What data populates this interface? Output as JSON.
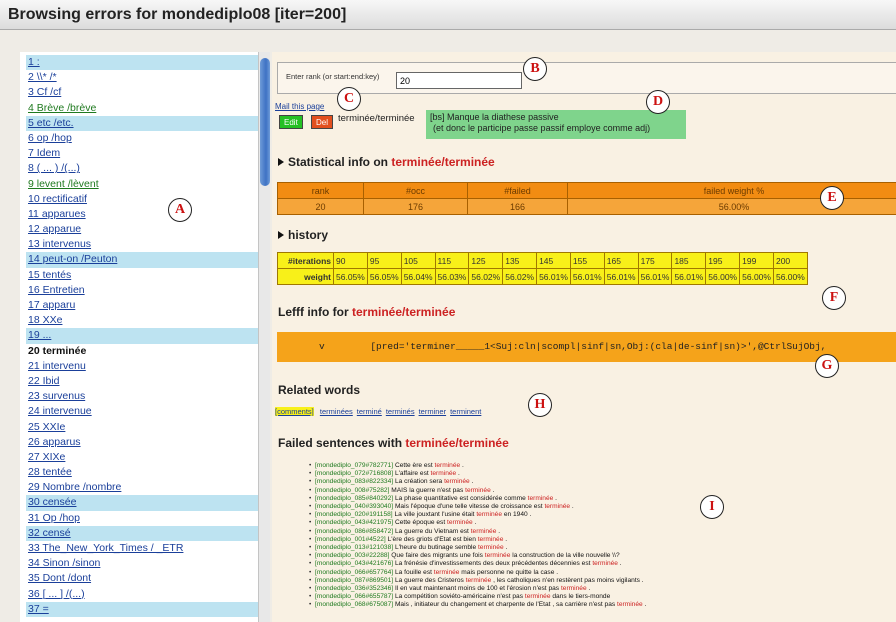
{
  "window": {
    "title": "Browsing errors for mondediplo08 [iter=200]"
  },
  "sidebar": {
    "items": [
      {
        "label": "1 :",
        "hl": true
      },
      {
        "label": "2 \\\\* /*",
        "hl": false
      },
      {
        "label": "3 Cf /cf",
        "hl": false
      },
      {
        "label": "4 Brève /brève",
        "hl": false
      },
      {
        "label": "5 etc /etc.",
        "hl": true
      },
      {
        "label": "6 op /hop",
        "hl": false
      },
      {
        "label": "7 Idem",
        "hl": false
      },
      {
        "label": "8 ( ... ) /(...)",
        "hl": false
      },
      {
        "label": "9 levent /lèvent",
        "hl": false
      },
      {
        "label": "10 rectificatif",
        "hl": false
      },
      {
        "label": "11 apparues",
        "hl": false
      },
      {
        "label": "12 apparue",
        "hl": false
      },
      {
        "label": "13 intervenus",
        "hl": false
      },
      {
        "label": "14 peut-on /Peuton",
        "hl": true
      },
      {
        "label": "15 tentés",
        "hl": false
      },
      {
        "label": "16 Entretien",
        "hl": false
      },
      {
        "label": "17 apparu",
        "hl": false
      },
      {
        "label": "18 XXe",
        "hl": false
      },
      {
        "label": "19 ...",
        "hl": true
      },
      {
        "label": "20 terminée",
        "hl": false,
        "current": true
      },
      {
        "label": "21 intervenu",
        "hl": false
      },
      {
        "label": "22 Ibid",
        "hl": false
      },
      {
        "label": "23 survenus",
        "hl": false
      },
      {
        "label": "24 intervenue",
        "hl": false
      },
      {
        "label": "25 XXIe",
        "hl": false
      },
      {
        "label": "26 apparus",
        "hl": false
      },
      {
        "label": "27 XIXe",
        "hl": false
      },
      {
        "label": "28 tentée",
        "hl": false
      },
      {
        "label": "29 Nombre /nombre",
        "hl": false
      },
      {
        "label": "30 censée",
        "hl": true
      },
      {
        "label": "31 Op /hop",
        "hl": false
      },
      {
        "label": "32 censé",
        "hl": true
      },
      {
        "label": "33 The_New_York_Times / _ETR",
        "hl": false
      },
      {
        "label": "34 Sinon /sinon",
        "hl": false
      },
      {
        "label": "35 Dont /dont",
        "hl": false
      },
      {
        "label": "36 [ ... ] /(...)",
        "hl": false
      },
      {
        "label": "37 =",
        "hl": true
      }
    ]
  },
  "rank": {
    "label": "Enter rank (or start:end:key)",
    "value": "20"
  },
  "entry": {
    "mail_link": "Mail this page",
    "edit_label": "Edit",
    "del_label": "Del",
    "word": "terminée/terminée",
    "comment_line1": "[bs]  Manque la diathese passive",
    "comment_line2": "(et donc le participe passe passif employe comme adj)"
  },
  "stats": {
    "title_prefix": "Statistical info on ",
    "title_word": "terminée/terminée",
    "headers": [
      "rank",
      "#occ",
      "#failed",
      "failed weight %"
    ],
    "values": [
      "20",
      "176",
      "166",
      "56.00%"
    ]
  },
  "history": {
    "title": "history",
    "row1_label": "#iterations",
    "row2_label": "weight",
    "iterations": [
      "90",
      "95",
      "105",
      "115",
      "125",
      "135",
      "145",
      "155",
      "165",
      "175",
      "185",
      "195",
      "199",
      "200"
    ],
    "weights": [
      "56.05%",
      "56.05%",
      "56.04%",
      "56.03%",
      "56.02%",
      "56.02%",
      "56.01%",
      "56.01%",
      "56.01%",
      "56.01%",
      "56.01%",
      "56.00%",
      "56.00%",
      "56.00%"
    ]
  },
  "lefff": {
    "title_prefix": "Lefff info for ",
    "title_word": "terminée/terminée",
    "category": "v",
    "content": "[pred='terminer_____1<Suj:cln|scompl|sinf|sn,Obj:(cla|de-sinf|sn)>',@CtrlSujObj,"
  },
  "related": {
    "title": "Related words",
    "comments_label": "[comments]",
    "words": [
      "terminées",
      "terminé",
      "terminés",
      "terminer",
      "terminent"
    ]
  },
  "failed": {
    "title_prefix": "Failed sentences with ",
    "title_word": "terminée/terminée",
    "sentences": [
      {
        "id": "[mondediplo_079#782771]",
        "before": " Cette ère est ",
        "word": "terminée",
        "after": " ."
      },
      {
        "id": "[mondediplo_072#716808]",
        "before": " L'affaire est ",
        "word": "terminée",
        "after": " ."
      },
      {
        "id": "[mondediplo_083#822334]",
        "before": " La création sera ",
        "word": "terminée",
        "after": " ."
      },
      {
        "id": "[mondediplo_008#75282]",
        "before": " MAIS la guerre n'est pas ",
        "word": "terminée",
        "after": " ."
      },
      {
        "id": "[mondediplo_085#840292]",
        "before": " La phase quantitative est considérée comme ",
        "word": "terminée",
        "after": " ."
      },
      {
        "id": "[mondediplo_040#393040]",
        "before": " Mais l'époque d'une telle vitesse de croissance est ",
        "word": "terminée",
        "after": " ."
      },
      {
        "id": "[mondediplo_020#191158]",
        "before": " La ville jouxtant l'usine était ",
        "word": "terminée",
        "after": " en 1940 ."
      },
      {
        "id": "[mondediplo_043#421975]",
        "before": " Cette époque est ",
        "word": "terminée",
        "after": " ."
      },
      {
        "id": "[mondediplo_086#858472]",
        "before": " La guerre du Vietnam est ",
        "word": "terminée",
        "after": " ."
      },
      {
        "id": "[mondediplo_001#4522]",
        "before": " L'ère des griots d'Etat est bien ",
        "word": "terminée",
        "after": " ."
      },
      {
        "id": "[mondediplo_013#121038]",
        "before": " L'heure du butinage semble ",
        "word": "terminée",
        "after": " ."
      },
      {
        "id": "[mondediplo_003#22288]",
        "before": " Que faire des migrants une fois ",
        "word": "terminée",
        "after": " la construction de la ville nouvelle \\\\?"
      },
      {
        "id": "[mondediplo_043#421676]",
        "before": " La frénésie d'investissements des deux précédentes décennies est ",
        "word": "terminée",
        "after": " ."
      },
      {
        "id": "[mondediplo_066#657764]",
        "before": " La fouille est ",
        "word": "terminée",
        "after": " mais personne ne quitte la case ."
      },
      {
        "id": "[mondediplo_087#869501]",
        "before": " La guerre des Cristeros ",
        "word": "terminée",
        "after": " , les catholiques n'en restèrent pas moins vigilants ."
      },
      {
        "id": "[mondediplo_036#352346]",
        "before": " Il en vaut maintenant moins de 100 et l'érosion n'est pas ",
        "word": "terminée",
        "after": " ."
      },
      {
        "id": "[mondediplo_066#655787]",
        "before": " La compétition soviéto-américaine n'est pas ",
        "word": "terminée",
        "after": " dans le tiers-monde"
      },
      {
        "id": "[mondediplo_068#675087]",
        "before": " Mais , initiateur du changement et charpente de l'Etat , sa carrière n'est pas ",
        "word": "terminée",
        "after": " ."
      }
    ]
  },
  "markers": [
    "A",
    "B",
    "C",
    "D",
    "E",
    "F",
    "G",
    "H",
    "I"
  ]
}
